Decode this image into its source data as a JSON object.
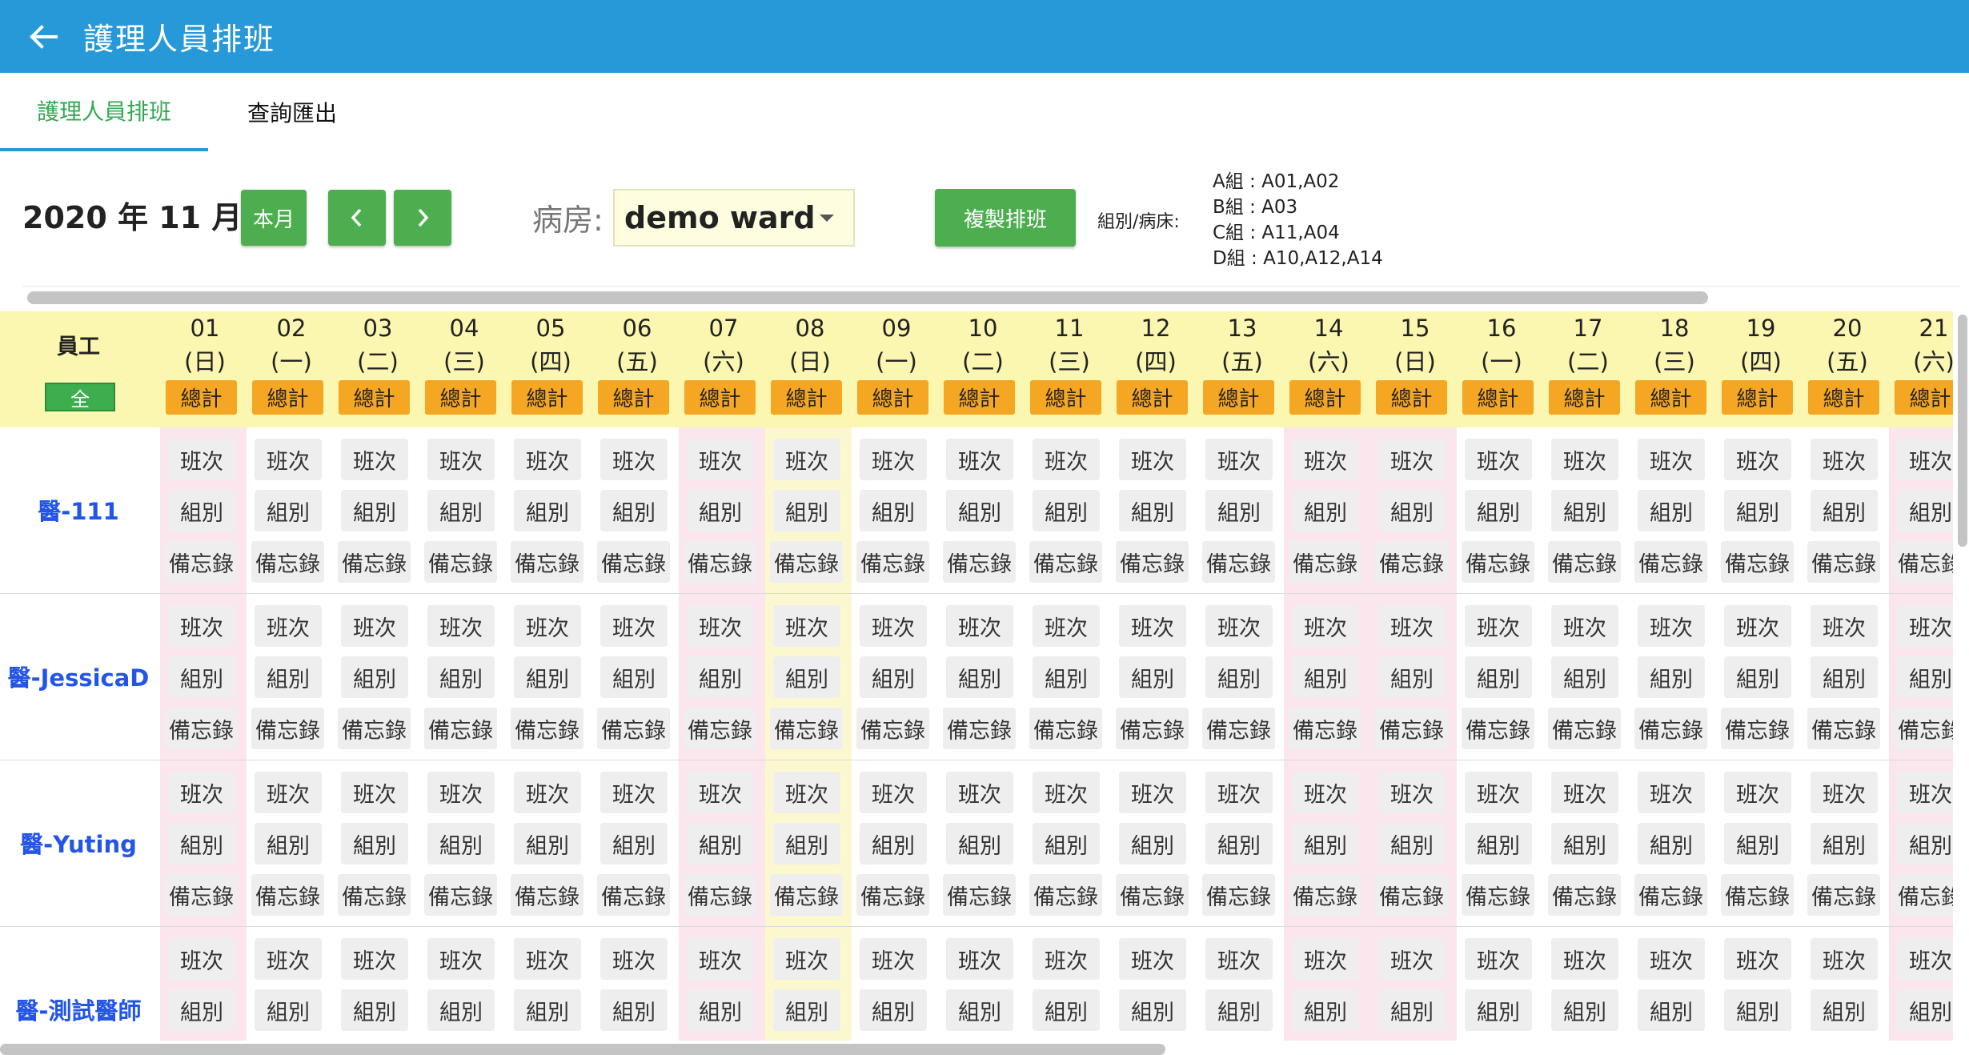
{
  "app": {
    "title": "護理人員排班"
  },
  "tabs": [
    {
      "label": "護理人員排班",
      "active": true
    },
    {
      "label": "查詢匯出",
      "active": false
    }
  ],
  "toolbar": {
    "year_month": "2020 年 11 月",
    "this_month_label": "本月",
    "ward_label": "病房:",
    "ward_value": "demo ward",
    "copy_label": "複製排班",
    "group_label": "組別/病床:",
    "groups": [
      "A組 : A01,A02",
      "B組 : A03",
      "C組 : A11,A04",
      "D組 : A10,A12,A14"
    ]
  },
  "grid": {
    "employee_header": "員工",
    "all_label": "全",
    "total_label": "總計",
    "cell_labels": {
      "shift": "班次",
      "group": "組別",
      "memo": "備忘錄"
    },
    "days": [
      {
        "num": "01",
        "weekday": "(日)",
        "type": "sun"
      },
      {
        "num": "02",
        "weekday": "(一)",
        "type": ""
      },
      {
        "num": "03",
        "weekday": "(二)",
        "type": ""
      },
      {
        "num": "04",
        "weekday": "(三)",
        "type": ""
      },
      {
        "num": "05",
        "weekday": "(四)",
        "type": ""
      },
      {
        "num": "06",
        "weekday": "(五)",
        "type": ""
      },
      {
        "num": "07",
        "weekday": "(六)",
        "type": "sat"
      },
      {
        "num": "08",
        "weekday": "(日)",
        "type": "today"
      },
      {
        "num": "09",
        "weekday": "(一)",
        "type": ""
      },
      {
        "num": "10",
        "weekday": "(二)",
        "type": ""
      },
      {
        "num": "11",
        "weekday": "(三)",
        "type": ""
      },
      {
        "num": "12",
        "weekday": "(四)",
        "type": ""
      },
      {
        "num": "13",
        "weekday": "(五)",
        "type": ""
      },
      {
        "num": "14",
        "weekday": "(六)",
        "type": "sat"
      },
      {
        "num": "15",
        "weekday": "(日)",
        "type": "sun"
      },
      {
        "num": "16",
        "weekday": "(一)",
        "type": ""
      },
      {
        "num": "17",
        "weekday": "(二)",
        "type": ""
      },
      {
        "num": "18",
        "weekday": "(三)",
        "type": ""
      },
      {
        "num": "19",
        "weekday": "(四)",
        "type": ""
      },
      {
        "num": "20",
        "weekday": "(五)",
        "type": ""
      },
      {
        "num": "21",
        "weekday": "(六)",
        "type": "sat"
      }
    ],
    "employees": [
      {
        "name": "醫-111"
      },
      {
        "name": "醫-JessicaD"
      },
      {
        "name": "醫-Yuting"
      },
      {
        "name": "醫-測試醫師"
      }
    ]
  },
  "icons": {
    "back": "arrow-left-icon",
    "prev": "chevron-left-icon",
    "next": "chevron-right-icon",
    "dropdown": "caret-down-icon"
  },
  "colors": {
    "appbar": "#2899d8",
    "accent_green": "#4cae4f",
    "total_orange": "#f5a623",
    "header_yellow": "#fbf6b0",
    "weekend_pink": "#fce6ee",
    "name_blue": "#2255e8"
  }
}
